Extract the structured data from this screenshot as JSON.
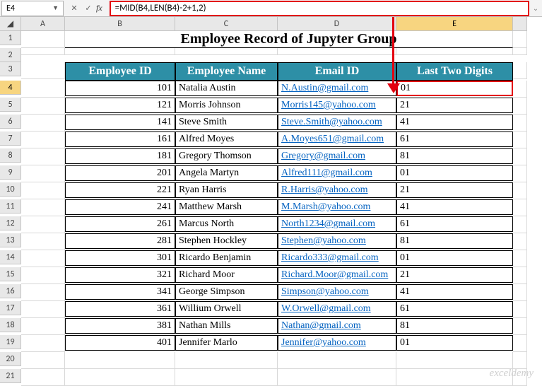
{
  "namebox": "E4",
  "formula": "=MID(B4,LEN(B4)-2+1,2)",
  "cols": [
    "A",
    "B",
    "C",
    "D",
    "E",
    ""
  ],
  "rows": [
    "1",
    "2",
    "3",
    "4",
    "5",
    "6",
    "7",
    "8",
    "9",
    "10",
    "11",
    "12",
    "13",
    "14",
    "15",
    "16",
    "17",
    "18",
    "19",
    "20",
    "21"
  ],
  "title": "Employee Record of Jupyter Group",
  "headers": {
    "b": "Employee ID",
    "c": "Employee Name",
    "d": "Email ID",
    "e": "Last Two Digits"
  },
  "data": [
    {
      "id": "101",
      "name": "Natalia Austin",
      "email": "N.Austin@gmail.com",
      "last": "01"
    },
    {
      "id": "121",
      "name": "Morris Johnson",
      "email": "Morris145@yahoo.com",
      "last": "21"
    },
    {
      "id": "141",
      "name": "Steve Smith",
      "email": "Steve.Smith@yahoo.com",
      "last": "41"
    },
    {
      "id": "161",
      "name": "Alfred Moyes",
      "email": "A.Moyes651@gmail.com",
      "last": "61"
    },
    {
      "id": "181",
      "name": "Gregory Thomson",
      "email": "Gregory@gmail.com",
      "last": "81"
    },
    {
      "id": "201",
      "name": "Angela Martyn",
      "email": "Alfred111@gmail.com",
      "last": "01"
    },
    {
      "id": "221",
      "name": "Ryan Harris",
      "email": "R.Harris@yahoo.com",
      "last": "21"
    },
    {
      "id": "241",
      "name": "Matthew Marsh",
      "email": "M.Marsh@yahoo.com",
      "last": "41"
    },
    {
      "id": "261",
      "name": "Marcus North",
      "email": "North1234@gmail.com",
      "last": "61"
    },
    {
      "id": "281",
      "name": "Stephen Hockley",
      "email": "Stephen@yahoo.com",
      "last": "81"
    },
    {
      "id": "301",
      "name": "Ricardo Benjamin",
      "email": "Ricardo333@gmail.com",
      "last": "01"
    },
    {
      "id": "321",
      "name": "Richard Moor",
      "email": "Richard.Moor@gmail.com",
      "last": "21"
    },
    {
      "id": "341",
      "name": "George Simpson",
      "email": "Simpson@yahoo.com",
      "last": "41"
    },
    {
      "id": "361",
      "name": "Willium Orwell",
      "email": "W.Orwell@gmail.com",
      "last": "61"
    },
    {
      "id": "381",
      "name": "Nathan Mills",
      "email": "Nathan@gmail.com",
      "last": "81"
    },
    {
      "id": "401",
      "name": "Jennifer Marlo",
      "email": "Jennifer@yahoo.com",
      "last": "01"
    }
  ],
  "watermark": "exceldemy"
}
